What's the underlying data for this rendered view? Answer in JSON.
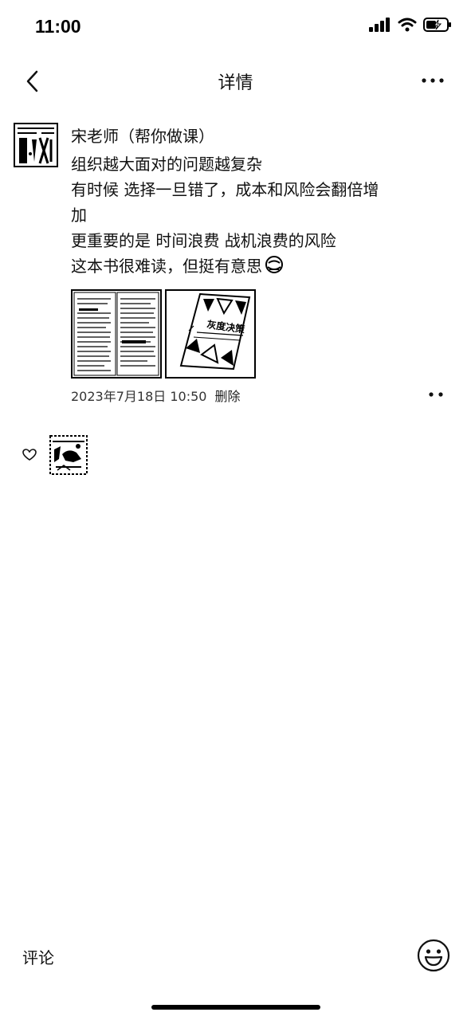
{
  "status_bar": {
    "time": "11:00"
  },
  "nav": {
    "title": "详情"
  },
  "post": {
    "author": "宋老师（帮你做课）",
    "lines": [
      "组织越大面对的问题越复杂",
      "有时候 选择一旦错了，成本和风险会翻倍增",
      "加",
      "更重要的是 时间浪费 战机浪费的风险",
      "这本书很难读，但挺有意思"
    ],
    "timestamp": "2023年7月18日 10:50",
    "delete_label": "删除",
    "book_cover_title": "灰度决策"
  },
  "bottom": {
    "comment_label": "评论"
  }
}
